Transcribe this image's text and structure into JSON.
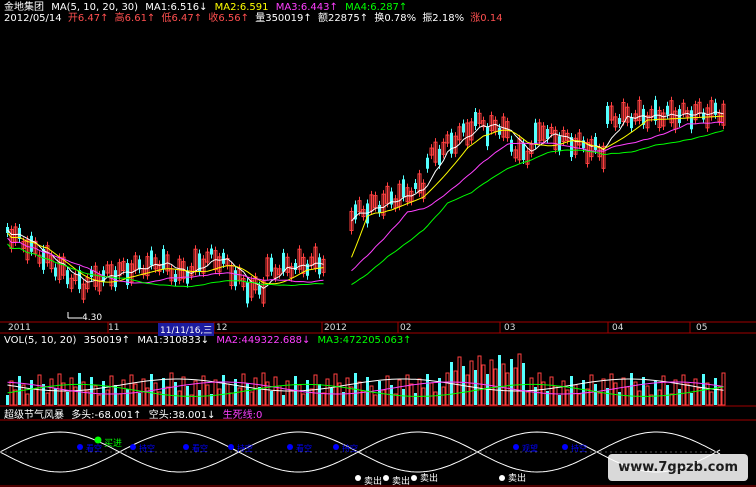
{
  "header": {
    "stock_name": "金地集团",
    "ma_label": "MA(5, 10, 20, 30)",
    "ma1": "MA1:6.516↓",
    "ma2": "MA2:6.591",
    "ma3": "MA3:6.443↑",
    "ma4": "MA4:6.287↑",
    "date": "2012/05/14",
    "open": "开6.47↑",
    "high": "高6.61↑",
    "low": "低6.47↑",
    "close": "收6.56↑",
    "volume": "量350019↑",
    "amount": "额22875↑",
    "turnover": "换0.78%",
    "amplitude": "振2.18%",
    "change": "涨0.14"
  },
  "time_axis": {
    "labels": [
      "2011",
      "11",
      "11/11/16,三",
      "12",
      "2012",
      "02",
      "03",
      "04",
      "05"
    ],
    "selected": "11/11/16,三"
  },
  "low_marker": "4.30",
  "vol_header": {
    "label": "VOL(5, 10, 20)",
    "vol": "350019↑",
    "ma1": "MA1:310833↓",
    "ma2": "MA2:449322.688↓",
    "ma3": "MA3:472205.063↑"
  },
  "ind_header": {
    "label": "超级节气风暴",
    "bull": "多头:-68.001↑",
    "bear": "空头:38.001↓",
    "life": "生死线:0"
  },
  "signals": {
    "buy_label": "买进",
    "sell_labels": [
      "卖出",
      "卖出",
      "卖出",
      "卖出"
    ],
    "small_labels": [
      "看空",
      "持空",
      "看空",
      "持空",
      "看空",
      "持空",
      "观望",
      "持空"
    ]
  },
  "colors": {
    "up": "#ff4040",
    "down": "#54ffff",
    "ma1": "#ffffff",
    "ma2": "#ffff00",
    "ma3": "#ff40ff",
    "ma4": "#00ff00",
    "axis": "#a00000",
    "signal_blue": "#0000ff",
    "buy_green": "#00ff00"
  },
  "watermark": "www.7gpzb.com"
}
